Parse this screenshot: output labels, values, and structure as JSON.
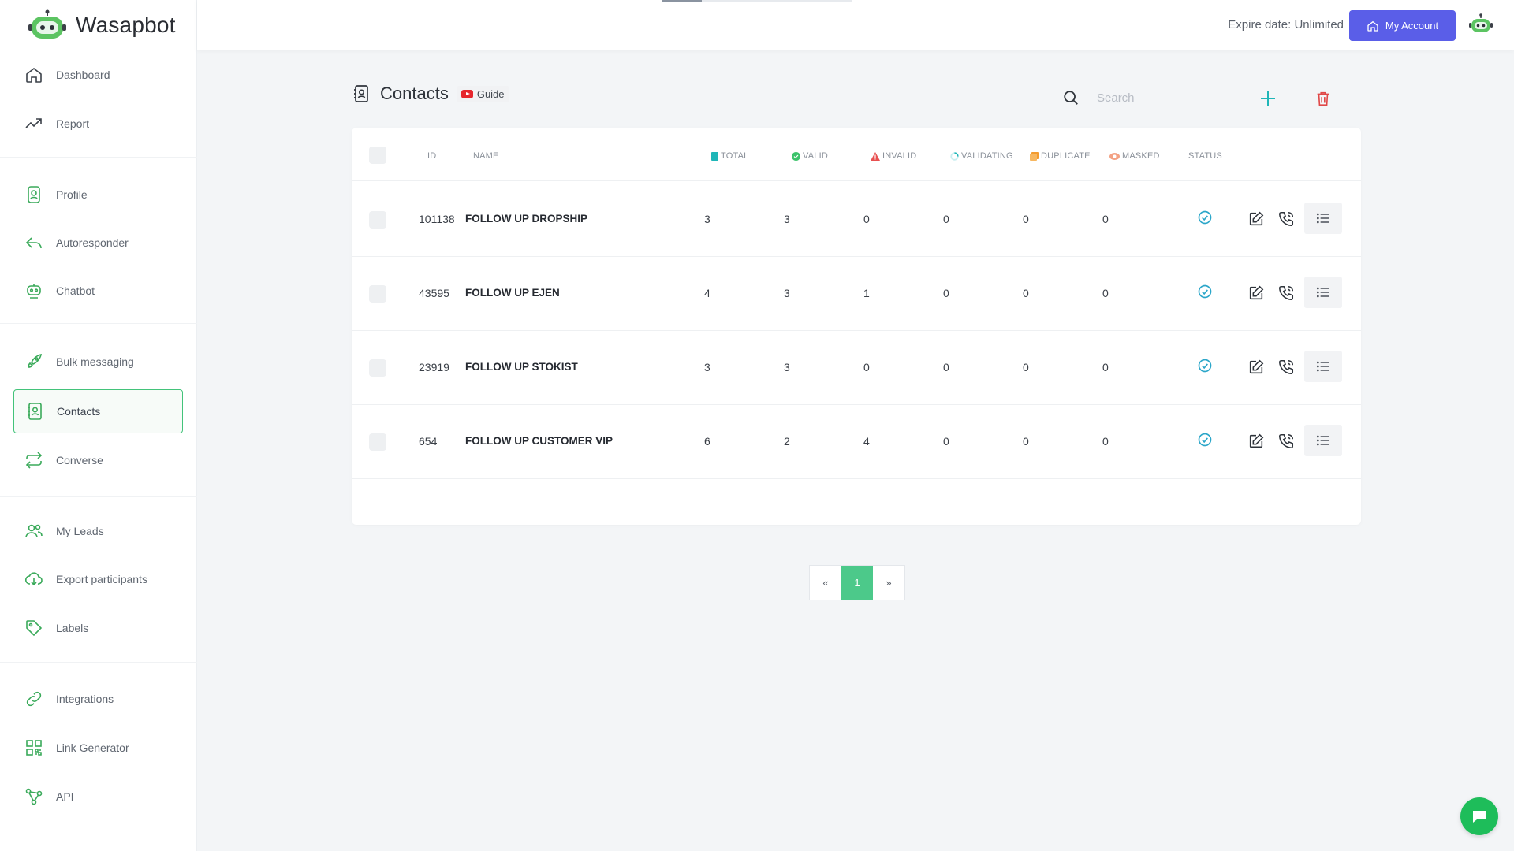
{
  "brand": {
    "name": "Wasapbot"
  },
  "sidebar": {
    "items": [
      {
        "label": "Dashboard",
        "icon": "home-icon"
      },
      {
        "label": "Report",
        "icon": "trend-icon"
      },
      {
        "label": "Profile",
        "icon": "profile-icon"
      },
      {
        "label": "Autoresponder",
        "icon": "reply-icon"
      },
      {
        "label": "Chatbot",
        "icon": "robot-icon"
      },
      {
        "label": "Bulk messaging",
        "icon": "rocket-icon"
      },
      {
        "label": "Contacts",
        "icon": "contacts-icon",
        "active": true
      },
      {
        "label": "Converse",
        "icon": "repeat-icon"
      },
      {
        "label": "My Leads",
        "icon": "users-icon"
      },
      {
        "label": "Export participants",
        "icon": "cloud-download-icon"
      },
      {
        "label": "Labels",
        "icon": "tag-icon"
      },
      {
        "label": "Integrations",
        "icon": "link-icon"
      },
      {
        "label": "Link Generator",
        "icon": "qr-icon"
      },
      {
        "label": "API",
        "icon": "api-icon"
      }
    ]
  },
  "topbar": {
    "expire": "Expire date: Unlimited",
    "account_label": "My Account"
  },
  "page": {
    "title": "Contacts",
    "guide_label": "Guide"
  },
  "search": {
    "placeholder": "Search"
  },
  "table": {
    "columns": {
      "id": "ID",
      "name": "NAME",
      "total": "TOTAL",
      "valid": "VALID",
      "invalid": "INVALID",
      "validating": "VALIDATING",
      "duplicate": "DUPLICATE",
      "masked": "MASKED",
      "status": "STATUS"
    },
    "rows": [
      {
        "id": "101138",
        "name": "FOLLOW UP DROPSHIP",
        "total": "3",
        "valid": "3",
        "invalid": "0",
        "validating": "0",
        "duplicate": "0",
        "masked": "0"
      },
      {
        "id": "43595",
        "name": "FOLLOW UP EJEN",
        "total": "4",
        "valid": "3",
        "invalid": "1",
        "validating": "0",
        "duplicate": "0",
        "masked": "0"
      },
      {
        "id": "23919",
        "name": "FOLLOW UP STOKIST",
        "total": "3",
        "valid": "3",
        "invalid": "0",
        "validating": "0",
        "duplicate": "0",
        "masked": "0"
      },
      {
        "id": "654",
        "name": "FOLLOW UP CUSTOMER VIP",
        "total": "6",
        "valid": "2",
        "invalid": "4",
        "validating": "0",
        "duplicate": "0",
        "masked": "0"
      }
    ]
  },
  "pagination": {
    "prev": "«",
    "current": "1",
    "next": "»"
  },
  "colors": {
    "accent": "#43c37a",
    "primary": "#5a5ee8",
    "danger": "#e04848",
    "status": "#2ba6c9"
  }
}
